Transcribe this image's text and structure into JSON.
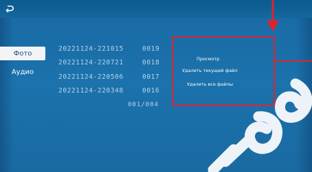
{
  "sidebar": {
    "items": [
      {
        "label": "Фото",
        "active": true
      },
      {
        "label": "Аудио",
        "active": false
      }
    ]
  },
  "files": [
    {
      "name": "20221124-221015",
      "number": "0019"
    },
    {
      "name": "20221124-220721",
      "number": "0018"
    },
    {
      "name": "20221124-220506",
      "number": "0017"
    },
    {
      "name": "20221124-220348",
      "number": "0016"
    }
  ],
  "pagination": {
    "counter": "001/004"
  },
  "context_menu": {
    "items": [
      "Просмотр",
      "Удалить текущий файл",
      "Удалить все файлы"
    ]
  },
  "colors": {
    "background": "#1a6fa8",
    "highlight": "#e0232b",
    "active_tab": "#f2f4f6"
  },
  "icons": {
    "back": "back-arrow-icon"
  }
}
